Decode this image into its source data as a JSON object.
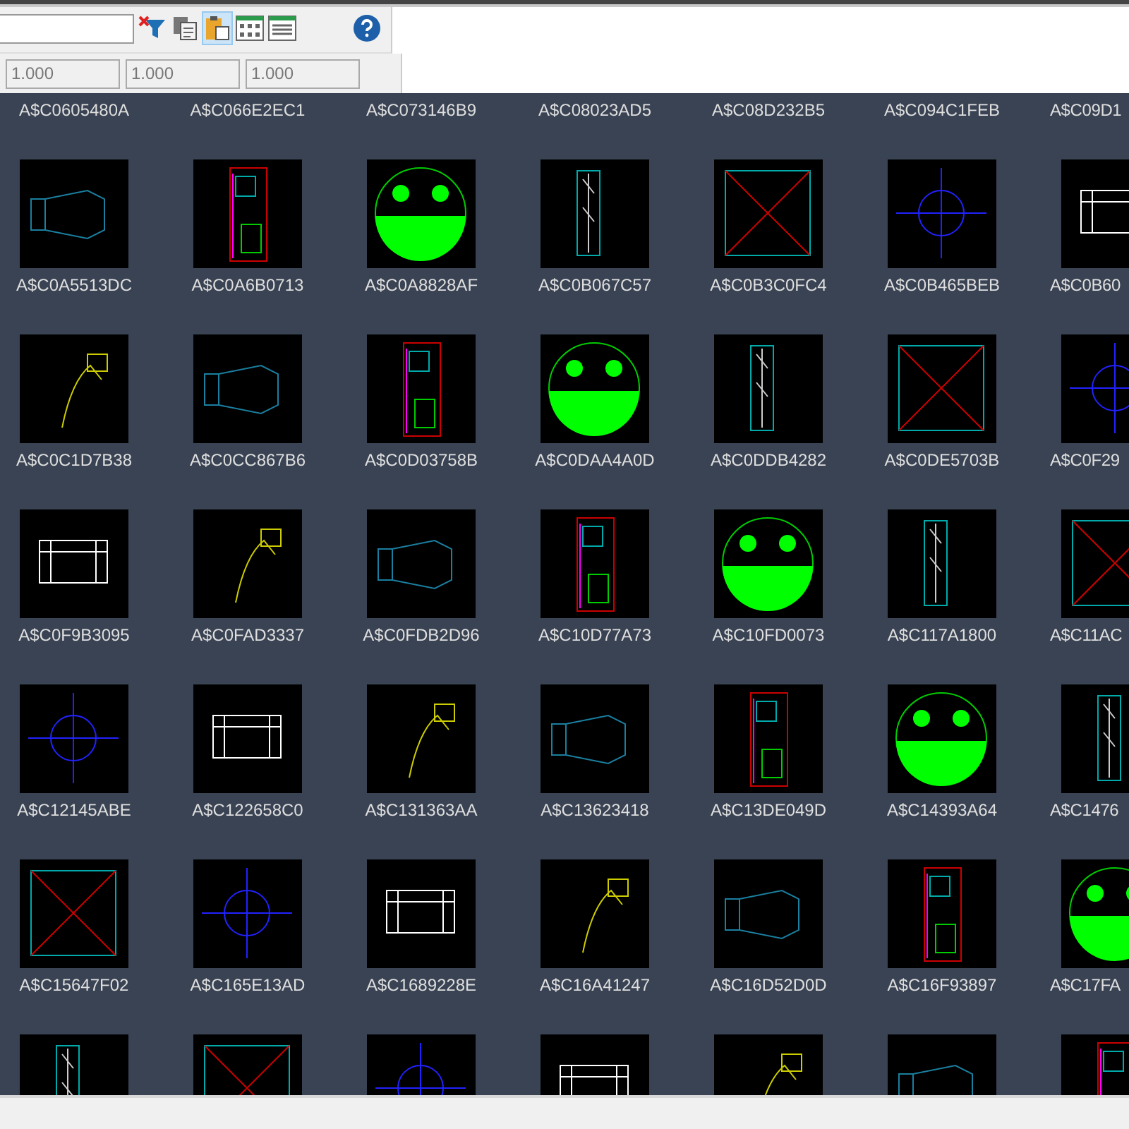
{
  "toolbar": {
    "buttons": [
      {
        "kind": "filter-clear",
        "selected": false
      },
      {
        "kind": "copy",
        "selected": false
      },
      {
        "kind": "paste",
        "selected": true
      },
      {
        "kind": "grid-view",
        "selected": false
      },
      {
        "kind": "list-view",
        "selected": false
      },
      {
        "kind": "help",
        "selected": false
      }
    ],
    "scale_fields": [
      {
        "value": "1.000"
      },
      {
        "value": "1.000"
      },
      {
        "value": "1.000"
      }
    ]
  },
  "blocks": [
    {
      "label": "A$C0605480A",
      "thumbnail": false
    },
    {
      "label": "A$C066E2EC1",
      "thumbnail": false
    },
    {
      "label": "A$C073146B9",
      "thumbnail": false
    },
    {
      "label": "A$C08023AD5",
      "thumbnail": false
    },
    {
      "label": "A$C08D232B5",
      "thumbnail": false
    },
    {
      "label": "A$C094C1FEB",
      "thumbnail": false
    },
    {
      "label": "A$C09D1",
      "thumbnail": false
    },
    {
      "label": "A$C0A5513DC",
      "thumbnail": true
    },
    {
      "label": "A$C0A6B0713",
      "thumbnail": true
    },
    {
      "label": "A$C0A8828AF",
      "thumbnail": true
    },
    {
      "label": "A$C0B067C57",
      "thumbnail": true
    },
    {
      "label": "A$C0B3C0FC4",
      "thumbnail": true
    },
    {
      "label": "A$C0B465BEB",
      "thumbnail": true
    },
    {
      "label": "A$C0B60",
      "thumbnail": true
    },
    {
      "label": "A$C0C1D7B38",
      "thumbnail": true
    },
    {
      "label": "A$C0CC867B6",
      "thumbnail": true
    },
    {
      "label": "A$C0D03758B",
      "thumbnail": true
    },
    {
      "label": "A$C0DAA4A0D",
      "thumbnail": true
    },
    {
      "label": "A$C0DDB4282",
      "thumbnail": true
    },
    {
      "label": "A$C0DE5703B",
      "thumbnail": true
    },
    {
      "label": "A$C0F29",
      "thumbnail": true
    },
    {
      "label": "A$C0F9B3095",
      "thumbnail": true
    },
    {
      "label": "A$C0FAD3337",
      "thumbnail": true
    },
    {
      "label": "A$C0FDB2D96",
      "thumbnail": true
    },
    {
      "label": "A$C10D77A73",
      "thumbnail": true
    },
    {
      "label": "A$C10FD0073",
      "thumbnail": true
    },
    {
      "label": "A$C117A1800",
      "thumbnail": true
    },
    {
      "label": "A$C11AC",
      "thumbnail": true
    },
    {
      "label": "A$C12145ABE",
      "thumbnail": true
    },
    {
      "label": "A$C122658C0",
      "thumbnail": true
    },
    {
      "label": "A$C131363AA",
      "thumbnail": true
    },
    {
      "label": "A$C13623418",
      "thumbnail": true
    },
    {
      "label": "A$C13DE049D",
      "thumbnail": true
    },
    {
      "label": "A$C14393A64",
      "thumbnail": true
    },
    {
      "label": "A$C1476",
      "thumbnail": true
    },
    {
      "label": "A$C15647F02",
      "thumbnail": true
    },
    {
      "label": "A$C165E13AD",
      "thumbnail": true
    },
    {
      "label": "A$C1689228E",
      "thumbnail": true
    },
    {
      "label": "A$C16A41247",
      "thumbnail": true
    },
    {
      "label": "A$C16D52D0D",
      "thumbnail": true
    },
    {
      "label": "A$C16F93897",
      "thumbnail": true
    },
    {
      "label": "A$C17FA",
      "thumbnail": true
    },
    {
      "thumbnail": true
    },
    {
      "thumbnail": true
    },
    {
      "thumbnail": true
    },
    {
      "thumbnail": true
    },
    {
      "thumbnail": true
    },
    {
      "thumbnail": true
    },
    {
      "thumbnail": true
    }
  ]
}
